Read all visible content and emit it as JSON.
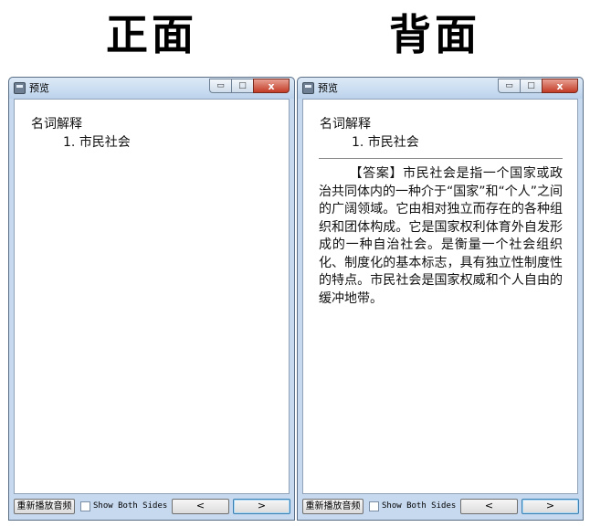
{
  "headings": {
    "front": "正面",
    "back": "背面"
  },
  "window": {
    "title": "预览",
    "controls": {
      "minimize": "▭",
      "maximize": "□",
      "close": "x"
    }
  },
  "card": {
    "section": "名词解释",
    "item": "1. 市民社会",
    "answer": "【答案】市民社会是指一个国家或政治共同体内的一种介于“国家”和“个人”之间的广阔领域。它由相对独立而存在的各种组织和团体构成。它是国家权利体育外自发形成的一种自治社会。是衡量一个社会组织化、制度化的基本标志，具有独立性制度性的特点。市民社会是国家权威和个人自由的缓冲地带。"
  },
  "footer": {
    "replay_label": "重新播放音频",
    "show_both_label": "Show Both Sides",
    "prev_label": "<",
    "next_label": ">"
  }
}
